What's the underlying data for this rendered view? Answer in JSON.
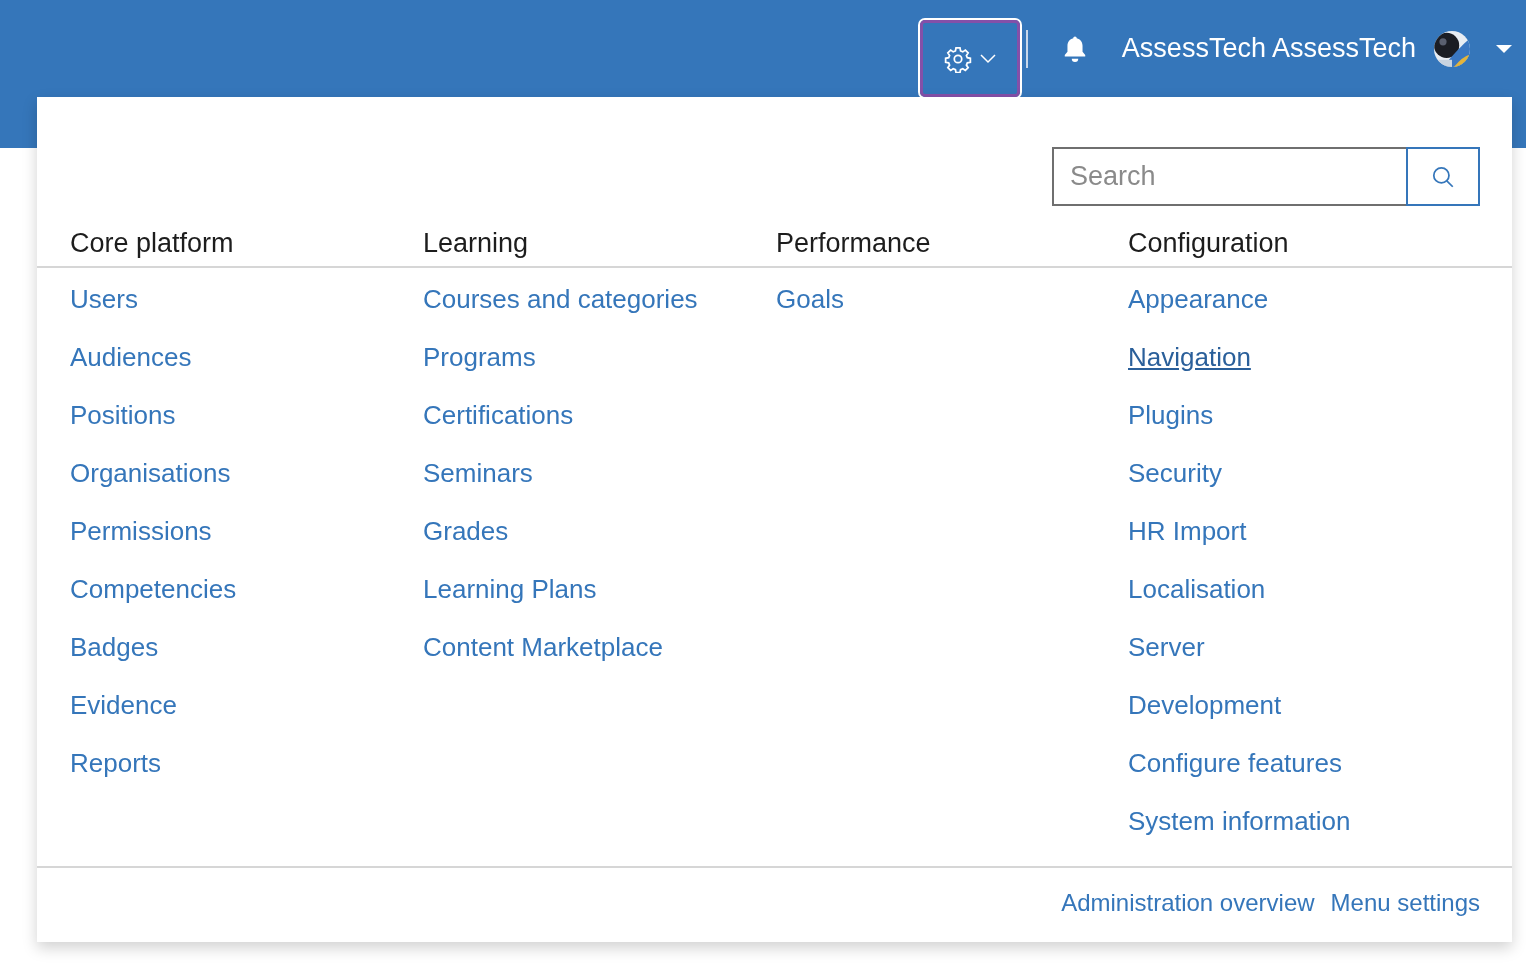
{
  "header": {
    "settings_button": {
      "focused": true
    },
    "user_name": "AssessTech AssessTech"
  },
  "admin_menu": {
    "search": {
      "placeholder": "Search"
    },
    "columns": [
      {
        "heading": "Core platform",
        "links": [
          {
            "label": "Users",
            "hovered": false
          },
          {
            "label": "Audiences",
            "hovered": false
          },
          {
            "label": "Positions",
            "hovered": false
          },
          {
            "label": "Organisations",
            "hovered": false
          },
          {
            "label": "Permissions",
            "hovered": false
          },
          {
            "label": "Competencies",
            "hovered": false
          },
          {
            "label": "Badges",
            "hovered": false
          },
          {
            "label": "Evidence",
            "hovered": false
          },
          {
            "label": "Reports",
            "hovered": false
          }
        ]
      },
      {
        "heading": "Learning",
        "links": [
          {
            "label": "Courses and categories",
            "hovered": false
          },
          {
            "label": "Programs",
            "hovered": false
          },
          {
            "label": "Certifications",
            "hovered": false
          },
          {
            "label": "Seminars",
            "hovered": false
          },
          {
            "label": "Grades",
            "hovered": false
          },
          {
            "label": "Learning Plans",
            "hovered": false
          },
          {
            "label": "Content Marketplace",
            "hovered": false
          }
        ]
      },
      {
        "heading": "Performance",
        "links": [
          {
            "label": "Goals",
            "hovered": false
          }
        ]
      },
      {
        "heading": "Configuration",
        "links": [
          {
            "label": "Appearance",
            "hovered": false
          },
          {
            "label": "Navigation",
            "hovered": true
          },
          {
            "label": "Plugins",
            "hovered": false
          },
          {
            "label": "Security",
            "hovered": false
          },
          {
            "label": "HR Import",
            "hovered": false
          },
          {
            "label": "Localisation",
            "hovered": false
          },
          {
            "label": "Server",
            "hovered": false
          },
          {
            "label": "Development",
            "hovered": false
          },
          {
            "label": "Configure features",
            "hovered": false
          },
          {
            "label": "System information",
            "hovered": false
          }
        ]
      }
    ],
    "footer_links": [
      "Administration overview",
      "Menu settings"
    ]
  }
}
